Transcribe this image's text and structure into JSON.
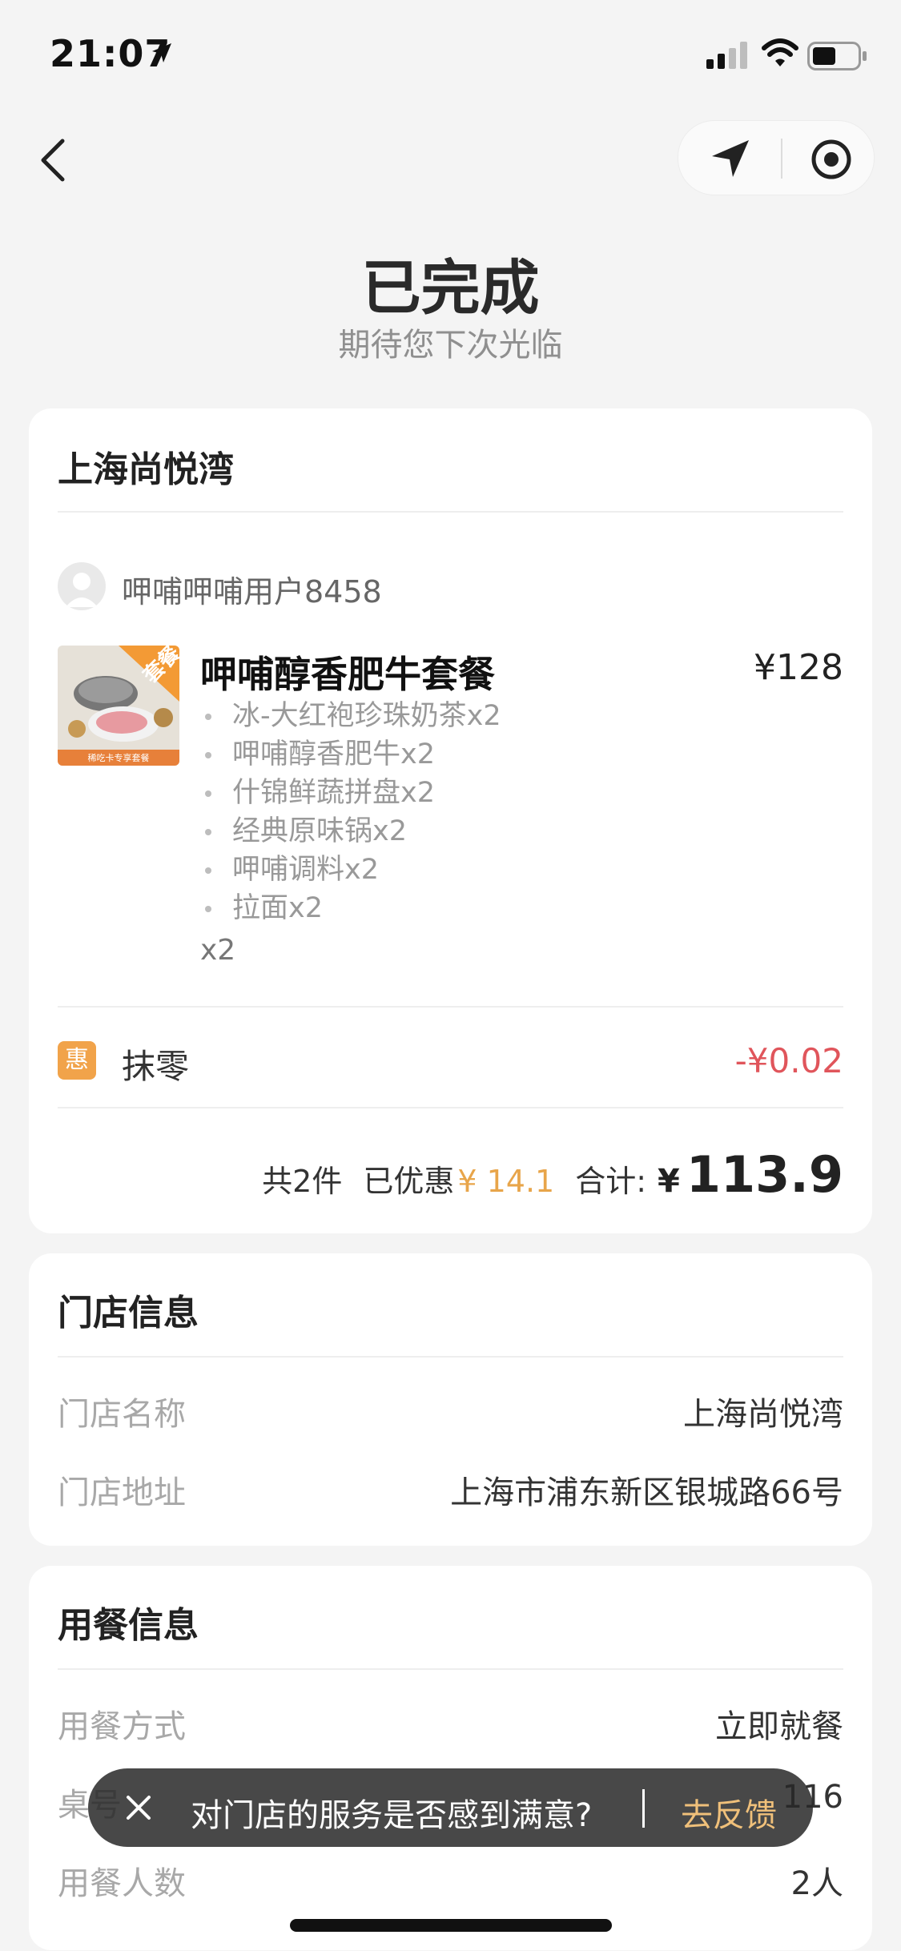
{
  "status_bar": {
    "time": "21:07"
  },
  "header": {
    "title": "已完成",
    "subtitle": "期待您下次光临"
  },
  "order": {
    "store_name": "上海尚悦湾",
    "user": "呷哺呷哺用户8458",
    "item": {
      "name": "呷哺醇香肥牛套餐",
      "price": "¥128",
      "thumb_badge": "套餐",
      "thumb_caption": "稀吃卡专享套餐",
      "sub_items": [
        "冰-大红袍珍珠奶茶x2",
        "呷哺醇香肥牛x2",
        "什锦鲜蔬拼盘x2",
        "经典原味锅x2",
        "呷哺调料x2",
        "拉面x2"
      ],
      "quantity": "x2"
    },
    "discount": {
      "badge": "惠",
      "label": "抹零",
      "amount": "-¥0.02"
    },
    "summary": {
      "count": "共2件",
      "saved_label": "已优惠",
      "saved_value": "¥ 14.1",
      "total_label": "合计:",
      "currency": "¥",
      "total": "113.9"
    }
  },
  "store_info": {
    "title": "门店信息",
    "rows": [
      {
        "label": "门店名称",
        "value": "上海尚悦湾"
      },
      {
        "label": "门店地址",
        "value": "上海市浦东新区银城路66号"
      }
    ]
  },
  "dining_info": {
    "title": "用餐信息",
    "rows": [
      {
        "label": "用餐方式",
        "value": "立即就餐"
      },
      {
        "label": "桌号",
        "value": "116"
      },
      {
        "label": "用餐人数",
        "value": "2人"
      }
    ]
  },
  "toast": {
    "text": "对门店的服务是否感到满意?",
    "action": "去反馈"
  },
  "colors": {
    "background": "#f4f4f4",
    "discount_red": "#e0555b",
    "saved_orange": "#e8a54a",
    "badge_orange": "#f1a34a",
    "toast_link": "#f0c07a"
  },
  "icons": [
    "location-arrow-icon",
    "signal-icon",
    "wifi-icon",
    "battery-icon",
    "back-icon",
    "navigate-icon",
    "record-icon",
    "close-icon"
  ]
}
